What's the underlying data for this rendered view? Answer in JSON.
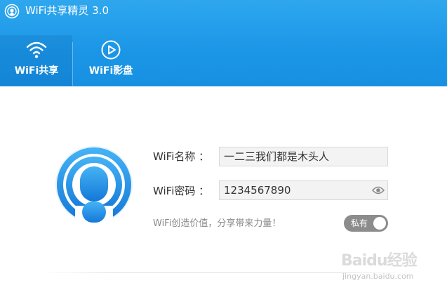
{
  "app": {
    "title": "WiFi共享精灵 3.0"
  },
  "tabs": [
    {
      "label": "WiFi共享",
      "icon": "wifi-icon",
      "active": true
    },
    {
      "label": "WiFi影盘",
      "icon": "play-circle-icon",
      "active": false
    }
  ],
  "form": {
    "name_label": "WiFi名称 ：",
    "name_value": "一二三我们都是木头人",
    "password_label": "WiFi密码 ：",
    "password_value": "1234567890",
    "slogan": "WiFi创造价值，分享带来力量！",
    "privacy_toggle_label": "私有",
    "privacy_toggle_on": true
  },
  "watermark": {
    "text": "Baidu经验",
    "sub": "jingyan.baidu.com"
  },
  "colors": {
    "header_blue": "#1b96e6",
    "logo_blue": "#1e8de6",
    "toggle_gray": "#8c8c8c"
  }
}
